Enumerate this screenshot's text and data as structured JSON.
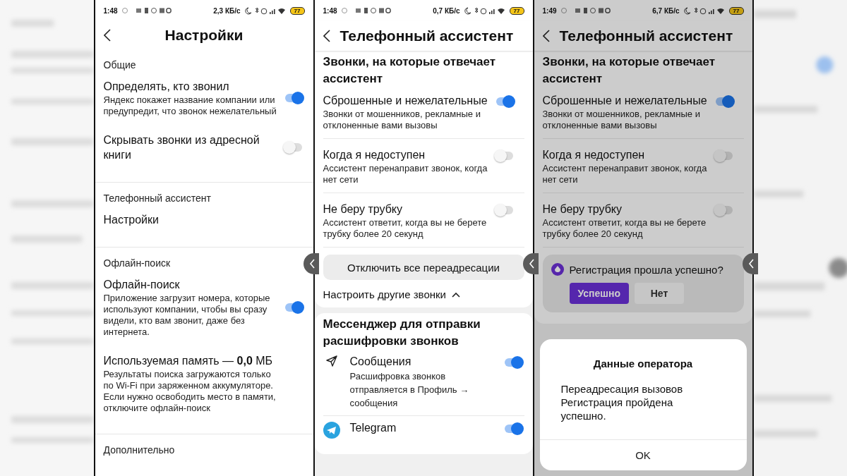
{
  "phones": [
    {
      "status": {
        "time": "1:48",
        "speed": "2,3 КБ/с",
        "battery": "77"
      },
      "header": {
        "kind": "centered",
        "title": "Настройки"
      },
      "dimmed": false,
      "sections": [
        {
          "kind": "group",
          "label": "Общие",
          "items": [
            {
              "kind": "toggle",
              "title": "Определять, кто звонил",
              "subtitle": "Яндекс покажет название компании или предупредит, что звонок нежелательный",
              "on": true
            },
            {
              "kind": "toggle",
              "title": "Скрывать звонки из адресной книги",
              "on": false
            }
          ]
        },
        {
          "kind": "group",
          "label": "Телефонный ассистент",
          "items": [
            {
              "kind": "link",
              "title": "Настройки"
            }
          ]
        },
        {
          "kind": "group",
          "label": "Офлайн-поиск",
          "items": [
            {
              "kind": "toggle",
              "title": "Офлайн-поиск",
              "subtitle": "Приложение загрузит номера, которые используют компании, чтобы вы сразу видели, кто вам звонит, даже без интернета.",
              "on": true
            },
            {
              "kind": "info",
              "title": "Используемая память — **0,0** МБ",
              "subtitle": "Результаты поиска загружаются только по Wi-Fi при заряженном аккумуляторе. Если нужно освободить место в памяти, отключите офлайн-поиск"
            }
          ]
        },
        {
          "kind": "group",
          "label": "Дополнительно"
        }
      ]
    },
    {
      "status": {
        "time": "1:48",
        "speed": "0,7 КБ/с",
        "battery": "77"
      },
      "header": {
        "kind": "left",
        "title": "Телефонный ассистент"
      },
      "dimmed": false,
      "sections": [
        {
          "kind": "card",
          "label": "Звонки, на которые отвечает ассистент",
          "items": [
            {
              "kind": "toggle",
              "title": "Сброшенные и нежелательные",
              "subtitle": "Звонки от мошенников, рекламные и отклоненные вами вызовы",
              "on": true
            },
            {
              "kind": "toggle",
              "title": "Когда я недоступен",
              "subtitle": "Ассистент перенаправит звонок, когда нет сети",
              "on": false
            },
            {
              "kind": "toggle",
              "title": "Не беру трубку",
              "subtitle": "Ассистент ответит, когда вы не берете трубку более 20 секунд",
              "on": false
            },
            {
              "kind": "button",
              "title": "Отключить все переадресации"
            },
            {
              "kind": "expander",
              "title": "Настроить другие звонки",
              "expanded": true
            }
          ]
        },
        {
          "kind": "card",
          "label": "Мессенджер для отправки расшифровки звонков",
          "items": [
            {
              "kind": "messenger",
              "title": "Сообщения",
              "subtitle": "Расшифровка звонков отправляется в Профиль → сообщения",
              "on": true
            },
            {
              "kind": "messenger",
              "title": "Telegram",
              "on": true
            }
          ]
        }
      ]
    },
    {
      "status": {
        "time": "1:49",
        "speed": "6,7 КБ/с",
        "battery": "77"
      },
      "header": {
        "kind": "left",
        "title": "Телефонный ассистент"
      },
      "dimmed": true,
      "sections": [
        {
          "kind": "card",
          "label": "Звонки, на которые отвечает ассистент",
          "items": [
            {
              "kind": "toggle",
              "title": "Сброшенные и нежелательные",
              "subtitle": "Звонки от мошенников, рекламные и отклоненные вами вызовы",
              "on": true
            },
            {
              "kind": "toggle",
              "title": "Когда я недоступен",
              "subtitle": "Ассистент перенаправит звонок, когда нет сети",
              "on": false
            },
            {
              "kind": "toggle",
              "title": "Не беру трубку",
              "subtitle": "Ассистент ответит, когда вы не берете трубку более 20 секунд",
              "on": false
            },
            {
              "kind": "prompt",
              "title": "Регистрация прошла успешно?",
              "buttons": [
                {
                  "label": "Успешно",
                  "selected": true
                },
                {
                  "label": "Нет",
                  "selected": false
                }
              ]
            }
          ]
        }
      ],
      "dialog": {
        "title": "Данные оператора",
        "lines": [
          "Переадресация вызовов",
          "Регистрация пройдена успешно."
        ],
        "button": "OK"
      }
    }
  ]
}
